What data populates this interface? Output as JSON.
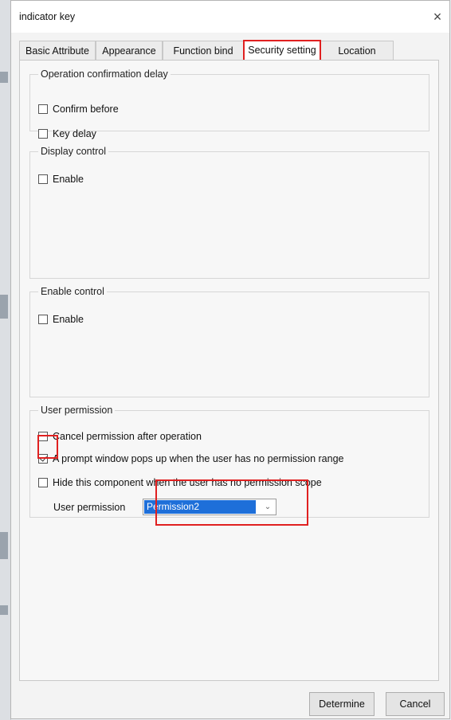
{
  "dialog": {
    "title": "indicator key",
    "close_glyph": "×"
  },
  "tabs": [
    {
      "label": "Basic Attribute",
      "active": false
    },
    {
      "label": "Appearance",
      "active": false
    },
    {
      "label": "Function bind",
      "active": false
    },
    {
      "label": "Security setting",
      "active": true
    },
    {
      "label": "Location",
      "active": false
    }
  ],
  "operation_confirmation": {
    "legend": "Operation confirmation delay",
    "confirm_before": {
      "label": "Confirm before",
      "checked": false
    },
    "key_delay": {
      "label": "Key delay",
      "checked": false
    }
  },
  "display_control": {
    "legend": "Display control",
    "enable": {
      "label": "Enable",
      "checked": false
    }
  },
  "enable_control": {
    "legend": "Enable control",
    "enable": {
      "label": "Enable",
      "checked": false
    }
  },
  "user_permission": {
    "legend": "User permission",
    "cancel_after_operation": {
      "label": "Cancel permission after operation",
      "checked": false
    },
    "prompt_window": {
      "label": "A prompt window pops up when the user has no permission range",
      "checked": true
    },
    "hide_component": {
      "label": "Hide this component when the user has no permission scope",
      "checked": false
    },
    "permission_select": {
      "label": "User permission",
      "value": "Permission2",
      "icon": "chevron-down-icon"
    }
  },
  "buttons": {
    "determine": "Determine",
    "cancel": "Cancel"
  },
  "colors": {
    "highlight": "#e02020",
    "selection": "#1e6fd9"
  }
}
